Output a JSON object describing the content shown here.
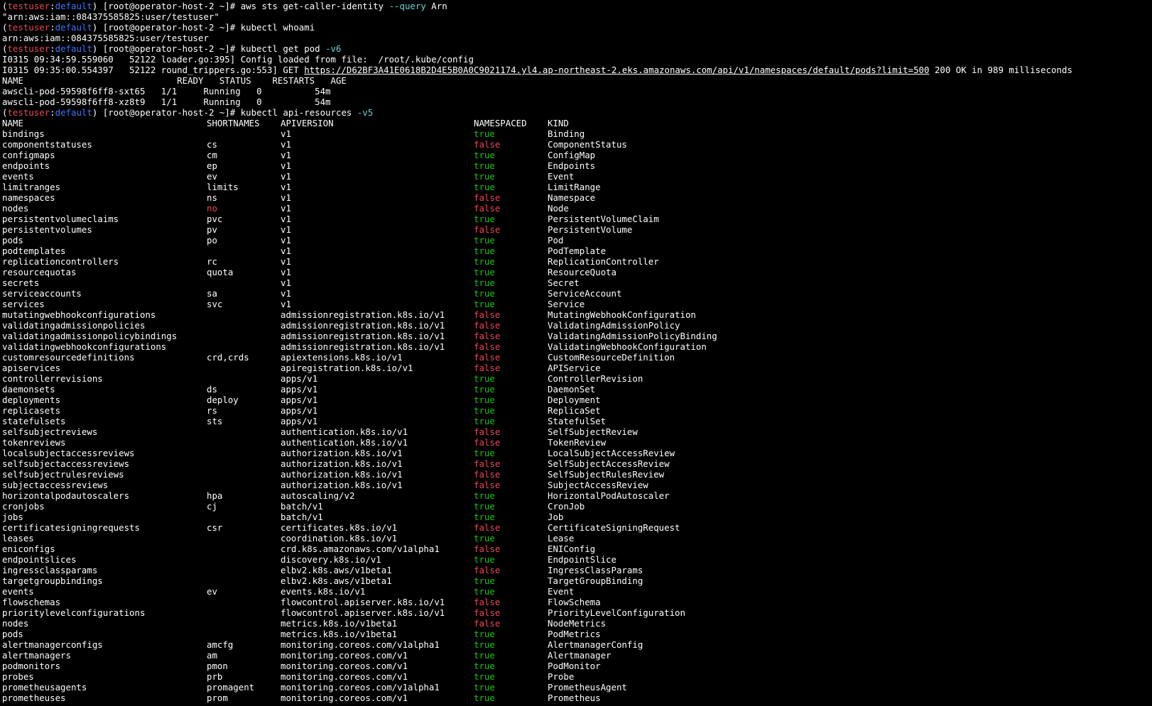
{
  "theme": {
    "background": "#000000",
    "foreground": "#ffffff",
    "prompt_user_color": "#e74856",
    "prompt_ctx_color": "#3b78ff",
    "flag_color": "#61d6d6",
    "true_color": "#16c60c",
    "false_color": "#e74856"
  },
  "prompt": {
    "open": "(",
    "user": "testuser",
    "sep": ":",
    "ctx": "default",
    "rest": ") [root@operator-host-2 ~]# "
  },
  "sessions": [
    {
      "command": "aws sts get-caller-identity ",
      "flag": "--query",
      "args": " Arn",
      "output": [
        "\"arn:aws:iam::084375585825:user/testuser\""
      ]
    },
    {
      "command": "kubectl whoami",
      "flag": "",
      "args": "",
      "output": [
        "arn:aws:iam::084375585825:user/testuser"
      ]
    },
    {
      "command": "kubectl get pod ",
      "flag": "-v6",
      "args": "",
      "output": []
    }
  ],
  "get_pod_log": {
    "line1": "I0315 09:34:59.559060   52122 loader.go:395] Config loaded from file:  /root/.kube/config",
    "line2_prefix": "I0315 09:35:00.554397   52122 round_trippers.go:553] GET ",
    "line2_url": "https://D62BF3A41E0618B2D4E5B0A0C9021174.yl4.ap-northeast-2.eks.amazonaws.com/api/v1/namespaces/default/pods?limit=500",
    "line2_suffix": " 200 OK in 989 milliseconds"
  },
  "pods_table": {
    "header": "NAME                             READY   STATUS    RESTARTS   AGE",
    "rows": [
      "awscli-pod-59598f6ff8-sxt65   1/1     Running   0          54m",
      "awscli-pod-59598f6ff8-xz8t9   1/1     Running   0          54m"
    ]
  },
  "api_command": {
    "command": "kubectl api-resources ",
    "flag": "-v5"
  },
  "api_resources": {
    "headers": [
      "NAME",
      "SHORTNAMES",
      "APIVERSION",
      "NAMESPACED",
      "KIND"
    ],
    "rows": [
      [
        "bindings",
        "",
        "v1",
        "true",
        "Binding"
      ],
      [
        "componentstatuses",
        "cs",
        "v1",
        "false",
        "ComponentStatus"
      ],
      [
        "configmaps",
        "cm",
        "v1",
        "true",
        "ConfigMap"
      ],
      [
        "endpoints",
        "ep",
        "v1",
        "true",
        "Endpoints"
      ],
      [
        "events",
        "ev",
        "v1",
        "true",
        "Event"
      ],
      [
        "limitranges",
        "limits",
        "v1",
        "true",
        "LimitRange"
      ],
      [
        "namespaces",
        "ns",
        "v1",
        "false",
        "Namespace"
      ],
      [
        "nodes",
        "no",
        "v1",
        "false",
        "Node"
      ],
      [
        "persistentvolumeclaims",
        "pvc",
        "v1",
        "true",
        "PersistentVolumeClaim"
      ],
      [
        "persistentvolumes",
        "pv",
        "v1",
        "false",
        "PersistentVolume"
      ],
      [
        "pods",
        "po",
        "v1",
        "true",
        "Pod"
      ],
      [
        "podtemplates",
        "",
        "v1",
        "true",
        "PodTemplate"
      ],
      [
        "replicationcontrollers",
        "rc",
        "v1",
        "true",
        "ReplicationController"
      ],
      [
        "resourcequotas",
        "quota",
        "v1",
        "true",
        "ResourceQuota"
      ],
      [
        "secrets",
        "",
        "v1",
        "true",
        "Secret"
      ],
      [
        "serviceaccounts",
        "sa",
        "v1",
        "true",
        "ServiceAccount"
      ],
      [
        "services",
        "svc",
        "v1",
        "true",
        "Service"
      ],
      [
        "mutatingwebhookconfigurations",
        "",
        "admissionregistration.k8s.io/v1",
        "false",
        "MutatingWebhookConfiguration"
      ],
      [
        "validatingadmissionpolicies",
        "",
        "admissionregistration.k8s.io/v1",
        "false",
        "ValidatingAdmissionPolicy"
      ],
      [
        "validatingadmissionpolicybindings",
        "",
        "admissionregistration.k8s.io/v1",
        "false",
        "ValidatingAdmissionPolicyBinding"
      ],
      [
        "validatingwebhookconfigurations",
        "",
        "admissionregistration.k8s.io/v1",
        "false",
        "ValidatingWebhookConfiguration"
      ],
      [
        "customresourcedefinitions",
        "crd,crds",
        "apiextensions.k8s.io/v1",
        "false",
        "CustomResourceDefinition"
      ],
      [
        "apiservices",
        "",
        "apiregistration.k8s.io/v1",
        "false",
        "APIService"
      ],
      [
        "controllerrevisions",
        "",
        "apps/v1",
        "true",
        "ControllerRevision"
      ],
      [
        "daemonsets",
        "ds",
        "apps/v1",
        "true",
        "DaemonSet"
      ],
      [
        "deployments",
        "deploy",
        "apps/v1",
        "true",
        "Deployment"
      ],
      [
        "replicasets",
        "rs",
        "apps/v1",
        "true",
        "ReplicaSet"
      ],
      [
        "statefulsets",
        "sts",
        "apps/v1",
        "true",
        "StatefulSet"
      ],
      [
        "selfsubjectreviews",
        "",
        "authentication.k8s.io/v1",
        "false",
        "SelfSubjectReview"
      ],
      [
        "tokenreviews",
        "",
        "authentication.k8s.io/v1",
        "false",
        "TokenReview"
      ],
      [
        "localsubjectaccessreviews",
        "",
        "authorization.k8s.io/v1",
        "true",
        "LocalSubjectAccessReview"
      ],
      [
        "selfsubjectaccessreviews",
        "",
        "authorization.k8s.io/v1",
        "false",
        "SelfSubjectAccessReview"
      ],
      [
        "selfsubjectrulesreviews",
        "",
        "authorization.k8s.io/v1",
        "false",
        "SelfSubjectRulesReview"
      ],
      [
        "subjectaccessreviews",
        "",
        "authorization.k8s.io/v1",
        "false",
        "SubjectAccessReview"
      ],
      [
        "horizontalpodautoscalers",
        "hpa",
        "autoscaling/v2",
        "true",
        "HorizontalPodAutoscaler"
      ],
      [
        "cronjobs",
        "cj",
        "batch/v1",
        "true",
        "CronJob"
      ],
      [
        "jobs",
        "",
        "batch/v1",
        "true",
        "Job"
      ],
      [
        "certificatesigningrequests",
        "csr",
        "certificates.k8s.io/v1",
        "false",
        "CertificateSigningRequest"
      ],
      [
        "leases",
        "",
        "coordination.k8s.io/v1",
        "true",
        "Lease"
      ],
      [
        "eniconfigs",
        "",
        "crd.k8s.amazonaws.com/v1alpha1",
        "false",
        "ENIConfig"
      ],
      [
        "endpointslices",
        "",
        "discovery.k8s.io/v1",
        "true",
        "EndpointSlice"
      ],
      [
        "ingressclassparams",
        "",
        "elbv2.k8s.aws/v1beta1",
        "false",
        "IngressClassParams"
      ],
      [
        "targetgroupbindings",
        "",
        "elbv2.k8s.aws/v1beta1",
        "true",
        "TargetGroupBinding"
      ],
      [
        "events",
        "ev",
        "events.k8s.io/v1",
        "true",
        "Event"
      ],
      [
        "flowschemas",
        "",
        "flowcontrol.apiserver.k8s.io/v1",
        "false",
        "FlowSchema"
      ],
      [
        "prioritylevelconfigurations",
        "",
        "flowcontrol.apiserver.k8s.io/v1",
        "false",
        "PriorityLevelConfiguration"
      ],
      [
        "nodes",
        "",
        "metrics.k8s.io/v1beta1",
        "false",
        "NodeMetrics"
      ],
      [
        "pods",
        "",
        "metrics.k8s.io/v1beta1",
        "true",
        "PodMetrics"
      ],
      [
        "alertmanagerconfigs",
        "amcfg",
        "monitoring.coreos.com/v1alpha1",
        "true",
        "AlertmanagerConfig"
      ],
      [
        "alertmanagers",
        "am",
        "monitoring.coreos.com/v1",
        "true",
        "Alertmanager"
      ],
      [
        "podmonitors",
        "pmon",
        "monitoring.coreos.com/v1",
        "true",
        "PodMonitor"
      ],
      [
        "probes",
        "prb",
        "monitoring.coreos.com/v1",
        "true",
        "Probe"
      ],
      [
        "prometheusagents",
        "promagent",
        "monitoring.coreos.com/v1alpha1",
        "true",
        "PrometheusAgent"
      ],
      [
        "prometheuses",
        "prom",
        "monitoring.coreos.com/v1",
        "true",
        "Prometheus"
      ]
    ]
  }
}
